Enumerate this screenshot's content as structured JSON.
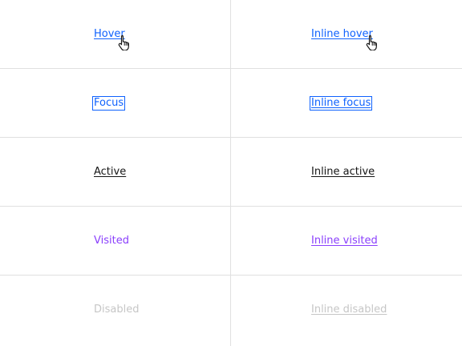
{
  "rows": [
    {
      "left": "Hover",
      "right": "Inline hover"
    },
    {
      "left": "Focus",
      "right": "Inline focus"
    },
    {
      "left": "Active",
      "right": "Inline active"
    },
    {
      "left": "Visited",
      "right": "Inline visited"
    },
    {
      "left": "Disabled",
      "right": "Inline disabled"
    }
  ],
  "colors": {
    "interactive": "#0f62fe",
    "active": "#161616",
    "visited": "#8a3ffc",
    "disabled": "#c6c6c6",
    "divider": "#e0e0e0"
  },
  "icons": {
    "cursor": "hand-pointer-icon"
  }
}
